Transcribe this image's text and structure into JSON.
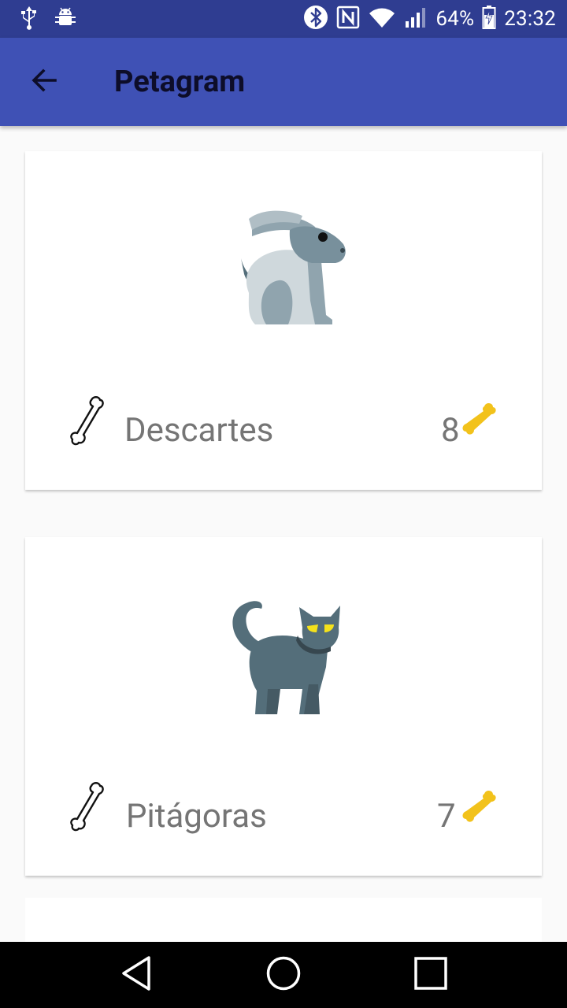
{
  "status_bar": {
    "battery_percent": "64%",
    "time": "23:32",
    "icons": [
      "usb-icon",
      "android-debug-icon",
      "bluetooth-icon",
      "nfc-icon",
      "wifi-icon",
      "signal-icon",
      "battery-charging-icon"
    ]
  },
  "app_bar": {
    "title": "Petagram",
    "back_icon": "arrow-back-icon"
  },
  "pets": [
    {
      "name": "Descartes",
      "likes": "8",
      "image": "rabbit",
      "rate_icon": "bone-outline-icon",
      "likes_icon": "bone-filled-icon"
    },
    {
      "name": "Pitágoras",
      "likes": "7",
      "image": "cat",
      "rate_icon": "bone-outline-icon",
      "likes_icon": "bone-filled-icon"
    }
  ],
  "nav_bar": {
    "buttons": [
      "back-triangle-icon",
      "home-circle-icon",
      "recents-square-icon"
    ]
  },
  "colors": {
    "status_bar": "#2f3d91",
    "app_bar": "#3f51b5",
    "like_bone": "#f2c21b",
    "text_secondary": "#757575"
  }
}
